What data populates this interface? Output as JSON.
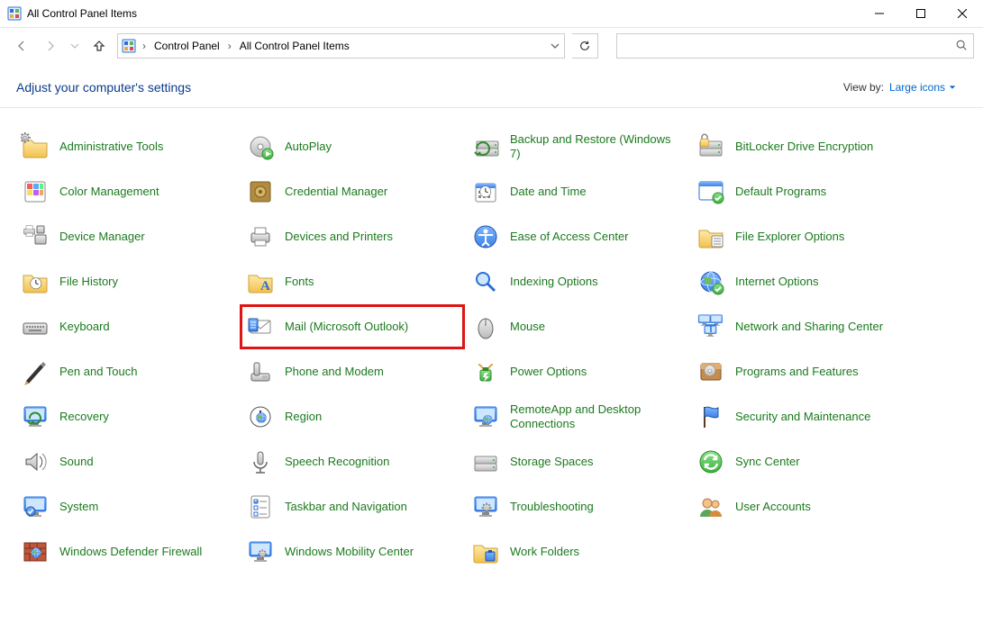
{
  "window": {
    "title": "All Control Panel Items"
  },
  "nav": {
    "breadcrumbs": {
      "root": "Control Panel",
      "current": "All Control Panel Items"
    },
    "search_placeholder": ""
  },
  "header": {
    "title": "Adjust your computer's settings",
    "view_by_label": "View by:",
    "view_by_value": "Large icons"
  },
  "items": [
    {
      "label": "Administrative Tools",
      "icon": "admin-tools",
      "selected": false
    },
    {
      "label": "AutoPlay",
      "icon": "autoplay",
      "selected": false
    },
    {
      "label": "Backup and Restore (Windows 7)",
      "icon": "backup-restore",
      "selected": false
    },
    {
      "label": "BitLocker Drive Encryption",
      "icon": "bitlocker",
      "selected": false
    },
    {
      "label": "Color Management",
      "icon": "color-management",
      "selected": false
    },
    {
      "label": "Credential Manager",
      "icon": "credential-manager",
      "selected": false
    },
    {
      "label": "Date and Time",
      "icon": "date-time",
      "selected": false
    },
    {
      "label": "Default Programs",
      "icon": "default-programs",
      "selected": false
    },
    {
      "label": "Device Manager",
      "icon": "device-manager",
      "selected": false
    },
    {
      "label": "Devices and Printers",
      "icon": "devices-printers",
      "selected": false
    },
    {
      "label": "Ease of Access Center",
      "icon": "ease-access",
      "selected": false
    },
    {
      "label": "File Explorer Options",
      "icon": "file-explorer-options",
      "selected": false
    },
    {
      "label": "File History",
      "icon": "file-history",
      "selected": false
    },
    {
      "label": "Fonts",
      "icon": "fonts",
      "selected": false
    },
    {
      "label": "Indexing Options",
      "icon": "indexing",
      "selected": false
    },
    {
      "label": "Internet Options",
      "icon": "internet-options",
      "selected": false
    },
    {
      "label": "Keyboard",
      "icon": "keyboard",
      "selected": false
    },
    {
      "label": "Mail (Microsoft Outlook)",
      "icon": "mail",
      "selected": true
    },
    {
      "label": "Mouse",
      "icon": "mouse",
      "selected": false
    },
    {
      "label": "Network and Sharing Center",
      "icon": "network-sharing",
      "selected": false
    },
    {
      "label": "Pen and Touch",
      "icon": "pen-touch",
      "selected": false
    },
    {
      "label": "Phone and Modem",
      "icon": "phone-modem",
      "selected": false
    },
    {
      "label": "Power Options",
      "icon": "power",
      "selected": false
    },
    {
      "label": "Programs and Features",
      "icon": "programs-features",
      "selected": false
    },
    {
      "label": "Recovery",
      "icon": "recovery",
      "selected": false
    },
    {
      "label": "Region",
      "icon": "region",
      "selected": false
    },
    {
      "label": "RemoteApp and Desktop Connections",
      "icon": "remoteapp",
      "selected": false
    },
    {
      "label": "Security and Maintenance",
      "icon": "security-maintenance",
      "selected": false
    },
    {
      "label": "Sound",
      "icon": "sound",
      "selected": false
    },
    {
      "label": "Speech Recognition",
      "icon": "speech",
      "selected": false
    },
    {
      "label": "Storage Spaces",
      "icon": "storage",
      "selected": false
    },
    {
      "label": "Sync Center",
      "icon": "sync",
      "selected": false
    },
    {
      "label": "System",
      "icon": "system",
      "selected": false
    },
    {
      "label": "Taskbar and Navigation",
      "icon": "taskbar",
      "selected": false
    },
    {
      "label": "Troubleshooting",
      "icon": "troubleshooting",
      "selected": false
    },
    {
      "label": "User Accounts",
      "icon": "user-accounts",
      "selected": false
    },
    {
      "label": "Windows Defender Firewall",
      "icon": "firewall",
      "selected": false
    },
    {
      "label": "Windows Mobility Center",
      "icon": "mobility",
      "selected": false
    },
    {
      "label": "Work Folders",
      "icon": "work-folders",
      "selected": false
    }
  ]
}
